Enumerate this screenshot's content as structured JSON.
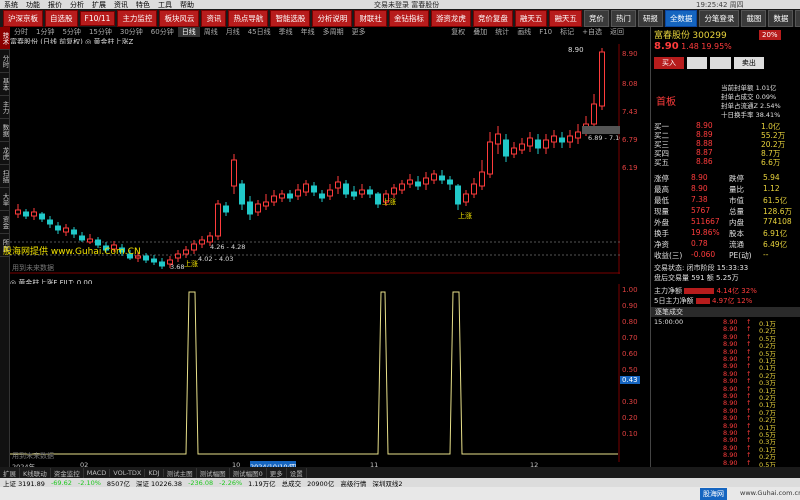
{
  "menu": {
    "items": [
      "系统",
      "功能",
      "报价",
      "分析",
      "扩展",
      "资讯",
      "特色",
      "工具",
      "帮助"
    ],
    "window_title": "交易未登录  富春股份",
    "clock": "19:25:42 周四"
  },
  "toolbar": {
    "buttons": [
      "沪深京板",
      "自选股",
      "F10/11",
      "主力监控",
      "板块风云",
      "资讯",
      "热点导航",
      "智能选股",
      "分析说明",
      "财联社",
      "金钻指标",
      "游资龙虎",
      "竞价复盘",
      "融天五",
      "融天五",
      "竞价",
      "热门",
      "研报",
      "全数据",
      "分笔登录",
      "截图",
      "数据",
      "恢复"
    ]
  },
  "periodbar": {
    "items": [
      "分时",
      "1分钟",
      "5分钟",
      "15分钟",
      "30分钟",
      "60分钟",
      "日线",
      "周线",
      "月线",
      "45日线",
      "季线",
      "年线",
      "多周期",
      "更多"
    ],
    "selected": "日线",
    "right": [
      "复权",
      "叠加",
      "统计",
      "画线",
      "F10",
      "标记",
      "+自选",
      "返回"
    ]
  },
  "chart": {
    "title": "富春股份 (日线 前复权) ◎ 黄金柱上涨Z",
    "price_axis": [
      "8.90",
      "8.08",
      "7.43",
      "6.79",
      "6.19"
    ],
    "annotations": {
      "high": "8.90",
      "range_high": "6.89 - 7.10",
      "range1": "4.26 - 4.28",
      "range2": "4.02 - 4.03",
      "low": "3.68",
      "up1": "上涨",
      "up2": "上涨",
      "up3": "上涨",
      "watermark_text": "用到未来数据"
    }
  },
  "indicator": {
    "title": "◎ 黄金柱上涨F  FILT: 0.00",
    "axis": [
      "1.00",
      "0.90",
      "0.80",
      "0.70",
      "0.60",
      "0.50",
      "0.43",
      "0.30",
      "0.20",
      "0.10"
    ],
    "marker": "0.43",
    "watermark_text": "用到未来数据"
  },
  "dates": [
    "2024年",
    "02",
    "10",
    "2024/10/10/四",
    "11",
    "12"
  ],
  "left_tabs": [
    "技术分析",
    "分时",
    "基本面",
    "主力",
    "数据",
    "龙虎榜",
    "扫描盘",
    "大单",
    "资金",
    "所属板块"
  ],
  "stock": {
    "name": "富春股份",
    "code": "300299",
    "price": "8.90",
    "change": "1.48",
    "pct": "19.95%",
    "buy_label": "买入",
    "sell_label": "卖出",
    "pct_badge": "20%",
    "board_label": "首板",
    "info1": "当前封单额 1.01亿",
    "info2": "封单占成交 0.09%",
    "info3": "封单占流通Z 2.54%",
    "info4": "十日换手率 38.41%",
    "bids": [
      {
        "label": "买一",
        "price": "8.90",
        "vol": "1.0亿"
      },
      {
        "label": "买二",
        "price": "8.89",
        "vol": "55.2万"
      },
      {
        "label": "买三",
        "price": "8.88",
        "vol": "20.2万"
      },
      {
        "label": "买四",
        "price": "8.87",
        "vol": "8.7万"
      },
      {
        "label": "买五",
        "price": "8.86",
        "vol": "6.6万"
      }
    ],
    "stats": [
      {
        "l1": "涨停",
        "v1": "8.90",
        "l2": "跌停",
        "v2": "5.94"
      },
      {
        "l1": "最高",
        "v1": "8.90",
        "l2": "量比",
        "v2": "1.12"
      },
      {
        "l1": "最低",
        "v1": "7.38",
        "l2": "市值",
        "v2": "61.5亿"
      },
      {
        "l1": "现量",
        "v1": "5767",
        "l2": "总量",
        "v2": "128.6万"
      },
      {
        "l1": "外盘",
        "v1": "511667",
        "l2": "内盘",
        "v2": "774108"
      },
      {
        "l1": "换手",
        "v1": "19.86%",
        "l2": "股本",
        "v2": "6.91亿"
      },
      {
        "l1": "净资",
        "v1": "0.78",
        "l2": "流通",
        "v2": "6.49亿"
      },
      {
        "l1": "收益(三)",
        "v1": "-0.060",
        "l2": "PE(动)",
        "v2": "--"
      }
    ],
    "trade_status": "交易状态: 闭市阶段 15:33:33",
    "after_trade": "盘后交易量 591  额 5.25万",
    "main_force": {
      "l1": "主力净额",
      "v1": "4.14亿",
      "p1": "32%",
      "l2": "5日主力净额",
      "v2": "4.97亿",
      "p2": "12%"
    },
    "ticks_title": "逐笔成交",
    "ticks": [
      {
        "t": "15:00:00",
        "p": "8.90",
        "v": "0.1万"
      },
      {
        "p": "8.90",
        "v": "0.2万"
      },
      {
        "p": "8.90",
        "v": "0.5万"
      },
      {
        "p": "8.90",
        "v": "0.2万"
      },
      {
        "p": "8.90",
        "v": "0.5万"
      },
      {
        "p": "8.90",
        "v": "0.1万"
      },
      {
        "p": "8.90",
        "v": "0.1万"
      },
      {
        "p": "8.90",
        "v": "0.2万"
      },
      {
        "p": "8.90",
        "v": "0.3万"
      },
      {
        "p": "8.90",
        "v": "0.1万"
      },
      {
        "p": "8.90",
        "v": "0.2万"
      },
      {
        "p": "8.90",
        "v": "0.1万"
      },
      {
        "p": "8.90",
        "v": "0.7万"
      },
      {
        "p": "8.90",
        "v": "0.2万"
      },
      {
        "p": "8.90",
        "v": "0.1万"
      },
      {
        "p": "8.90",
        "v": "0.5万"
      },
      {
        "p": "8.90",
        "v": "0.3万"
      },
      {
        "p": "8.90",
        "v": "0.1万"
      },
      {
        "p": "8.90",
        "v": "0.2万"
      },
      {
        "p": "8.90",
        "v": "0.5万"
      }
    ]
  },
  "bottom_tabs": [
    "扩展",
    "K线联动",
    "资金监控",
    "MACD",
    "VOL-TDX",
    "KDJ",
    "测试主图",
    "测试幅图",
    "测试幅图0",
    "更多",
    "设置"
  ],
  "status": {
    "items": [
      "上证 3191.89",
      "-69.62",
      "-2.10%",
      "8507亿",
      "深证 10226.38",
      "-236.08",
      "-2.26%",
      "1.19万亿",
      "总成交",
      "20900亿",
      "高级行情",
      "深圳双线2"
    ]
  },
  "watermark": {
    "logo": "股海网",
    "text": "www.Guhai.com.cn",
    "overlay": "股海网提供 www.Guhai.Com.CN"
  }
}
